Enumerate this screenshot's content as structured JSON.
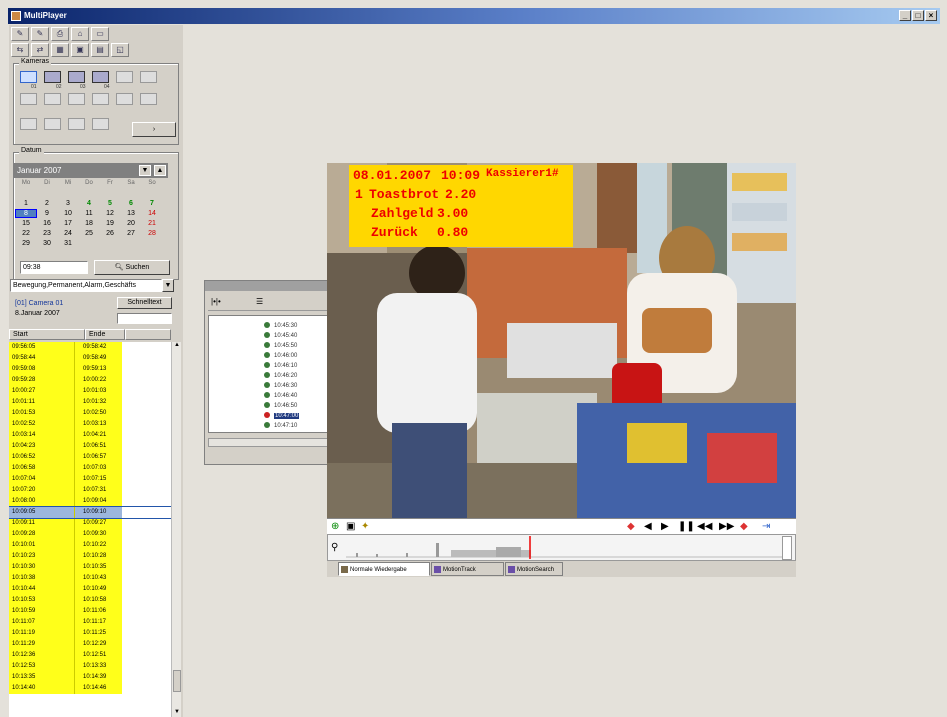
{
  "window": {
    "title": "MultiPlayer",
    "min": "_",
    "max": "□",
    "close": "×"
  },
  "toolbar": {
    "row1": [
      "✎",
      "✎",
      "⎙",
      "⌂",
      "▭"
    ],
    "row2": [
      "⇆",
      "⇄",
      "▦",
      "▣",
      "▤",
      "◱"
    ]
  },
  "cameras": {
    "label": "Kameras",
    "items": [
      {
        "name": "camera-01",
        "num": "01"
      },
      {
        "name": "camera-02",
        "num": "02"
      },
      {
        "name": "camera-03",
        "num": "03"
      },
      {
        "name": "camera-04",
        "num": "04"
      }
    ],
    "more_button": "›"
  },
  "date": {
    "label": "Datum",
    "month": "Januar 2007",
    "weekdays": [
      "Mo",
      "Di",
      "Mi",
      "Do",
      "Fr",
      "Sa",
      "So"
    ],
    "weeks": [
      [
        "",
        "",
        "",
        "",
        "",
        "",
        ""
      ],
      [
        "1",
        "2",
        "3",
        "4",
        "5",
        "6",
        "7"
      ],
      [
        "8",
        "9",
        "10",
        "11",
        "12",
        "13",
        "14"
      ],
      [
        "15",
        "16",
        "17",
        "18",
        "19",
        "20",
        "21"
      ],
      [
        "22",
        "23",
        "24",
        "25",
        "26",
        "27",
        "28"
      ],
      [
        "29",
        "30",
        "31",
        "",
        "",
        "",
        ""
      ]
    ],
    "time_value": "09:38",
    "search_button": "Suchen"
  },
  "filter": {
    "value": "Bewegung,Permanent,Alarm,Geschäfts"
  },
  "camera_info": {
    "line1": "[01] Camera 01",
    "line2": "8.Januar 2007",
    "quick_button": "Schnelltext"
  },
  "list": {
    "headers": [
      "Start",
      "Ende"
    ],
    "rows": [
      [
        "09:56:05",
        "09:58:42"
      ],
      [
        "09:58:44",
        "09:58:49"
      ],
      [
        "09:59:08",
        "09:59:13"
      ],
      [
        "09:59:28",
        "10:00:22"
      ],
      [
        "10:00:27",
        "10:01:03"
      ],
      [
        "10:01:11",
        "10:01:32"
      ],
      [
        "10:01:53",
        "10:02:50"
      ],
      [
        "10:02:52",
        "10:03:13"
      ],
      [
        "10:03:14",
        "10:04:21"
      ],
      [
        "10:04:23",
        "10:06:51"
      ],
      [
        "10:06:52",
        "10:06:57"
      ],
      [
        "10:06:58",
        "10:07:03"
      ],
      [
        "10:07:04",
        "10:07:15"
      ],
      [
        "10:07:20",
        "10:07:31"
      ],
      [
        "10:08:00",
        "10:09:04"
      ],
      [
        "10:09:05",
        "10:09:10"
      ],
      [
        "10:09:11",
        "10:09:27"
      ],
      [
        "10:09:28",
        "10:09:30"
      ],
      [
        "10:10:01",
        "10:10:22"
      ],
      [
        "10:10:23",
        "10:10:28"
      ],
      [
        "10:10:30",
        "10:10:35"
      ],
      [
        "10:10:38",
        "10:10:43"
      ],
      [
        "10:10:44",
        "10:10:49"
      ],
      [
        "10:10:53",
        "10:10:58"
      ],
      [
        "10:10:59",
        "10:11:06"
      ],
      [
        "10:11:07",
        "10:11:17"
      ],
      [
        "10:11:19",
        "10:11:25"
      ],
      [
        "10:11:29",
        "10:12:29"
      ],
      [
        "10:12:36",
        "10:12:51"
      ],
      [
        "10:12:53",
        "10:13:33"
      ],
      [
        "10:13:35",
        "10:14:39"
      ],
      [
        "10:14:40",
        "10:14:46"
      ]
    ],
    "selected_index": 15
  },
  "tree": {
    "nodes": [
      "10:45:30",
      "10:45:40",
      "10:45:50",
      "10:46:00",
      "10:46:10",
      "10:46:20",
      "10:46:30",
      "10:46:40",
      "10:46:50",
      "10:47:00",
      "10:47:10"
    ],
    "highlight_index": 9
  },
  "video": {
    "overlay": {
      "date": "08.01.2007",
      "time": "10:09",
      "cashier": "Kassierer1#",
      "item_qty": "1",
      "item": "Toastbrot",
      "item_price": "2.20",
      "paid_label": "Zahlgeld",
      "paid": "3.00",
      "change_label": "Zurück",
      "change": "0.80"
    }
  },
  "tabs": [
    "Normale Wiedergabe",
    "MotionTrack",
    "MotionSearch"
  ],
  "colors": {
    "list_highlight": "#ffff1a",
    "overlay_bg": "#ffd700",
    "overlay_text": "#e00000",
    "title_bar": "#0a246a"
  }
}
